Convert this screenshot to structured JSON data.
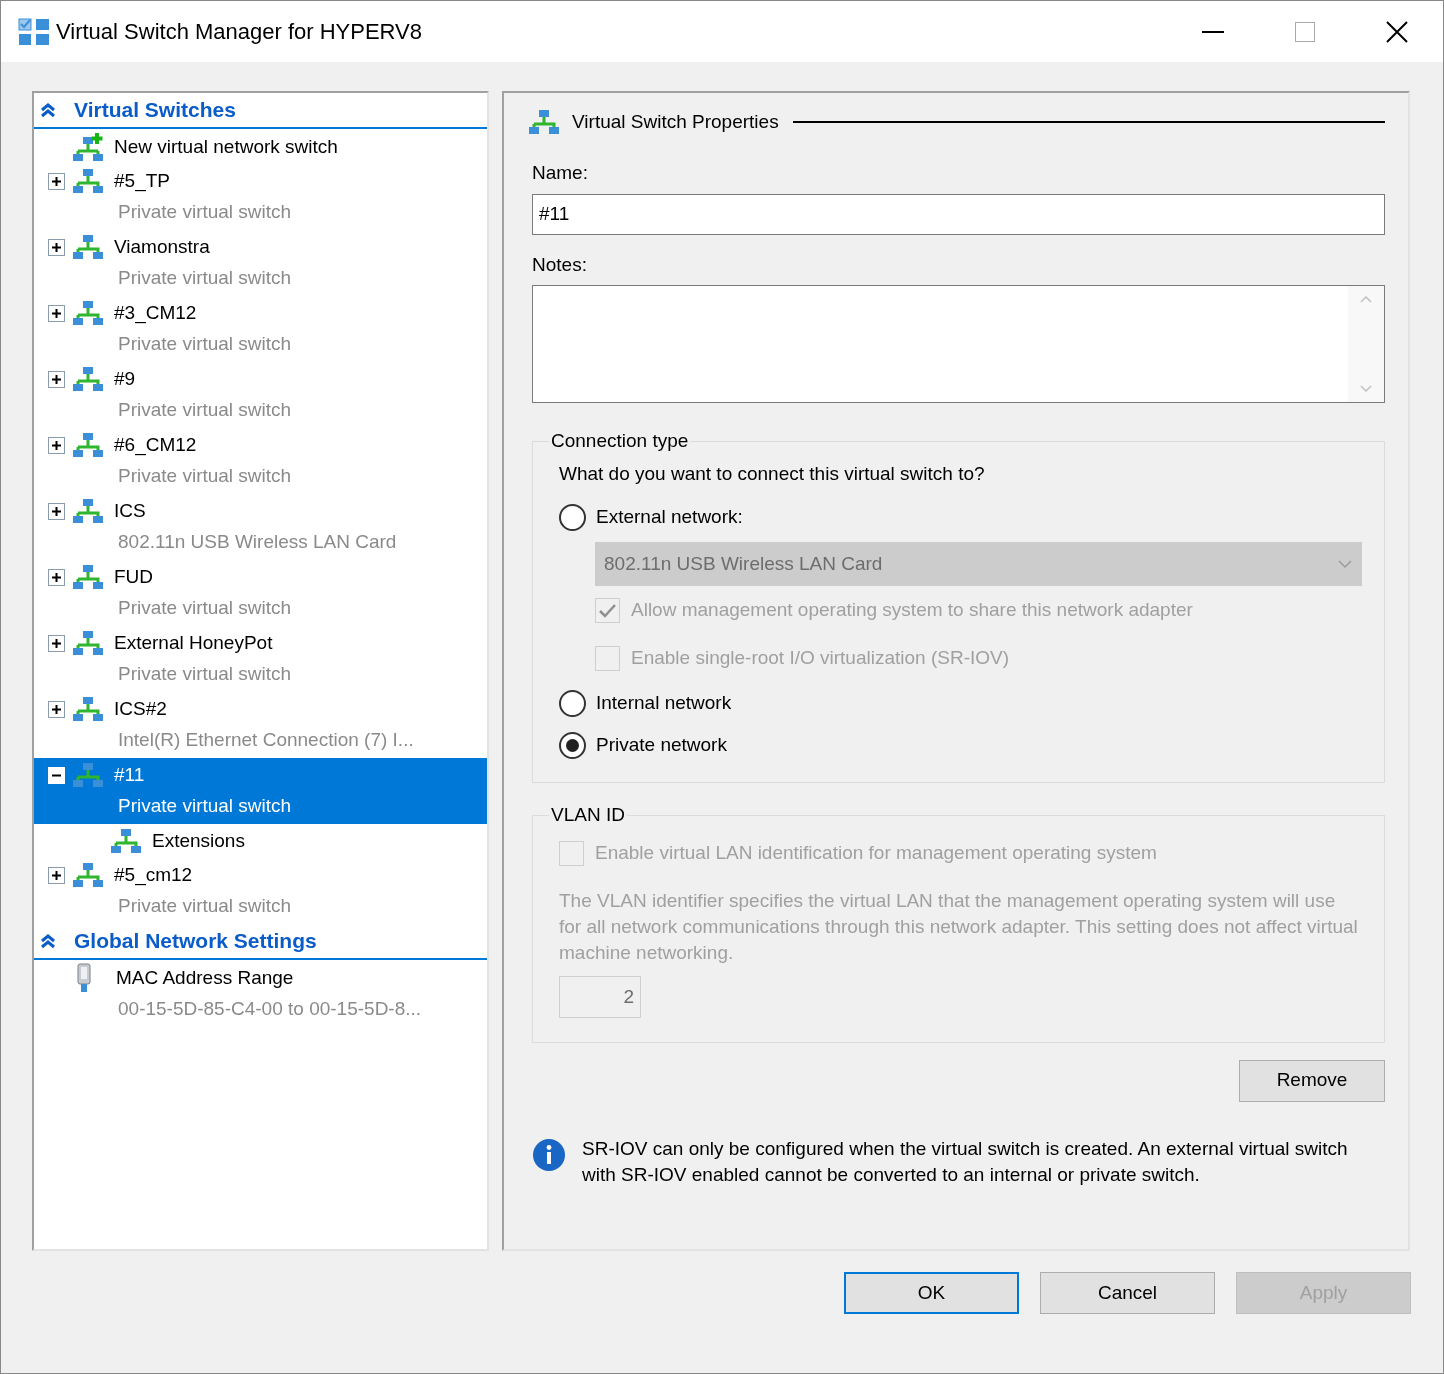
{
  "window": {
    "title": "Virtual Switch Manager for HYPERV8"
  },
  "sections": [
    {
      "title": "Virtual Switches",
      "expanded": true,
      "items": [
        {
          "kind": "new",
          "name": "New virtual network switch",
          "selected": false
        },
        {
          "kind": "switch",
          "name": "#5_TP",
          "subtitle": "Private virtual switch",
          "expanded": false,
          "selected": false
        },
        {
          "kind": "switch",
          "name": "Viamonstra",
          "subtitle": "Private virtual switch",
          "expanded": false,
          "selected": false
        },
        {
          "kind": "switch",
          "name": "#3_CM12",
          "subtitle": "Private virtual switch",
          "expanded": false,
          "selected": false
        },
        {
          "kind": "switch",
          "name": "#9",
          "subtitle": "Private virtual switch",
          "expanded": false,
          "selected": false
        },
        {
          "kind": "switch",
          "name": "#6_CM12",
          "subtitle": "Private virtual switch",
          "expanded": false,
          "selected": false
        },
        {
          "kind": "switch",
          "name": "ICS",
          "subtitle": "802.11n USB Wireless LAN Card",
          "expanded": false,
          "selected": false
        },
        {
          "kind": "switch",
          "name": "FUD",
          "subtitle": "Private virtual switch",
          "expanded": false,
          "selected": false
        },
        {
          "kind": "switch",
          "name": "External HoneyPot",
          "subtitle": "Private virtual switch",
          "expanded": false,
          "selected": false
        },
        {
          "kind": "switch",
          "name": "ICS#2",
          "subtitle": "Intel(R) Ethernet Connection (7) I...",
          "expanded": false,
          "selected": false
        },
        {
          "kind": "switch",
          "name": "#11",
          "subtitle": "Private virtual switch",
          "expanded": true,
          "selected": true,
          "children": [
            {
              "kind": "child",
              "name": "Extensions",
              "selected": false
            }
          ]
        },
        {
          "kind": "switch",
          "name": "#5_cm12",
          "subtitle": "Private virtual switch",
          "expanded": false,
          "selected": false
        }
      ]
    },
    {
      "title": "Global Network Settings",
      "expanded": true,
      "items": [
        {
          "kind": "mac",
          "name": "MAC Address Range",
          "subtitle": "00-15-5D-85-C4-00 to 00-15-5D-8...",
          "selected": false
        }
      ]
    }
  ],
  "properties": {
    "title": "Virtual Switch Properties",
    "name_label": "Name:",
    "name_value": "#11",
    "notes_label": "Notes:",
    "connection": {
      "title": "Connection type",
      "question": "What do you want to connect this virtual switch to?",
      "options": [
        {
          "label": "External network:",
          "selected": false,
          "adapter": {
            "value": "802.11n USB Wireless LAN Card",
            "disabled": true
          },
          "checkboxes": [
            {
              "label": "Allow management operating system to share this network adapter",
              "checked": true,
              "disabled": true
            },
            {
              "label": "Enable single-root I/O virtualization (SR-IOV)",
              "checked": false,
              "disabled": true
            }
          ]
        },
        {
          "label": "Internal network",
          "selected": false
        },
        {
          "label": "Private network",
          "selected": true
        }
      ]
    },
    "vlan": {
      "title": "VLAN ID",
      "checkbox": {
        "label": "Enable virtual LAN identification for management operating system",
        "checked": false,
        "disabled": true
      },
      "description": "The VLAN identifier specifies the virtual LAN that the management operating system will use for all network communications through this network adapter. This setting does not affect virtual machine networking.",
      "value": "2",
      "disabled": true
    },
    "remove_button": "Remove",
    "info": "SR-IOV can only be configured when the virtual switch is created. An external virtual switch with SR-IOV enabled cannot be converted to an internal or private switch."
  },
  "buttons": [
    {
      "label": "OK",
      "default": true,
      "disabled": false
    },
    {
      "label": "Cancel",
      "default": false,
      "disabled": false
    },
    {
      "label": "Apply",
      "default": false,
      "disabled": true
    }
  ]
}
